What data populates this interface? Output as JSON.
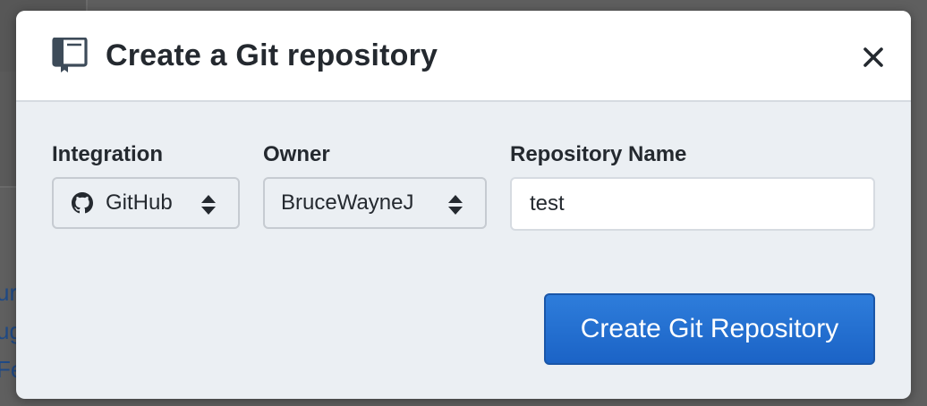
{
  "background": {
    "link_lines": [
      "ur",
      "ug",
      "Fe"
    ]
  },
  "modal": {
    "title": "Create a Git repository",
    "icons": {
      "header": "repo-book-icon",
      "close": "close-icon"
    },
    "fields": {
      "integration": {
        "label": "Integration",
        "value": "GitHub",
        "icon": "github-icon"
      },
      "owner": {
        "label": "Owner",
        "value": "BruceWayneJ"
      },
      "repository_name": {
        "label": "Repository Name",
        "value": "test"
      }
    },
    "submit_label": "Create Git Repository"
  },
  "colors": {
    "primary": "#1f6ed4",
    "modal_body": "#ebeff3",
    "title_text": "#24292f"
  }
}
